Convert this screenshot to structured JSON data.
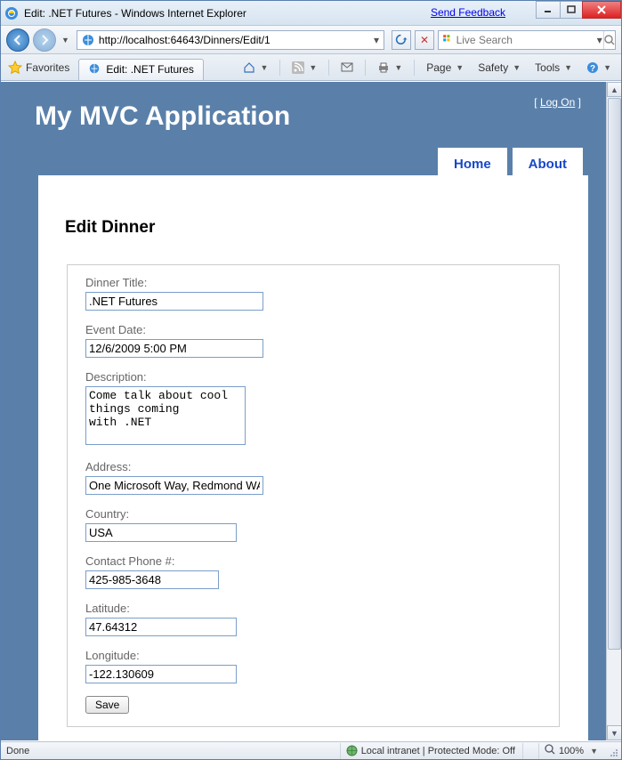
{
  "window": {
    "title": "Edit: .NET Futures - Windows Internet Explorer",
    "feedback": "Send Feedback"
  },
  "nav": {
    "url": "http://localhost:64643/Dinners/Edit/1",
    "search_placeholder": "Live Search"
  },
  "cmdbar": {
    "favorites": "Favorites",
    "tab_title": "Edit: .NET Futures",
    "page": "Page",
    "safety": "Safety",
    "tools": "Tools"
  },
  "app": {
    "logon_prefix": "[ ",
    "logon": "Log On",
    "logon_suffix": " ]",
    "title": "My MVC Application",
    "nav_home": "Home",
    "nav_about": "About"
  },
  "form": {
    "heading": "Edit Dinner",
    "title_label": "Dinner Title:",
    "title_value": ".NET Futures",
    "date_label": "Event Date:",
    "date_value": "12/6/2009 5:00 PM",
    "desc_label": "Description:",
    "desc_value": "Come talk about cool things coming\nwith .NET",
    "address_label": "Address:",
    "address_value": "One Microsoft Way, Redmond WA",
    "country_label": "Country:",
    "country_value": "USA",
    "phone_label": "Contact Phone #:",
    "phone_value": "425-985-3648",
    "lat_label": "Latitude:",
    "lat_value": "47.64312",
    "lon_label": "Longitude:",
    "lon_value": "-122.130609",
    "save": "Save"
  },
  "status": {
    "left": "Done",
    "zone": "Local intranet | Protected Mode: Off",
    "zoom": "100%"
  }
}
